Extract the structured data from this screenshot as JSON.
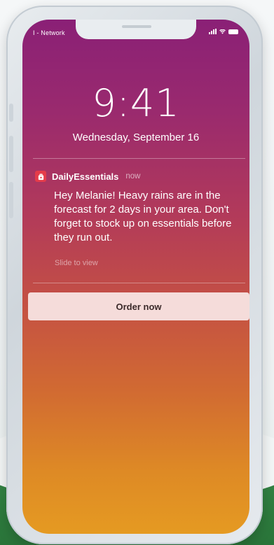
{
  "status_bar": {
    "carrier": "I - Network"
  },
  "lock_screen": {
    "time": "9:41",
    "date": "Wednesday, September 16"
  },
  "notification": {
    "app_icon": "gift-bag-icon",
    "app_name": "DailyEssentials",
    "time_ago": "now",
    "message": "Hey Melanie! Heavy rains are in the forecast for 2 days in your area. Don't forget to stock up on essentials before they run out.",
    "hint": "Slide to view",
    "action_label": "Order now"
  },
  "colors": {
    "gradient_top": "#8a2076",
    "gradient_bottom": "#e59a22",
    "app_icon_bg": "#e53b4a",
    "action_bg": "#f5dcda",
    "background_green": "#2e7d3f"
  }
}
